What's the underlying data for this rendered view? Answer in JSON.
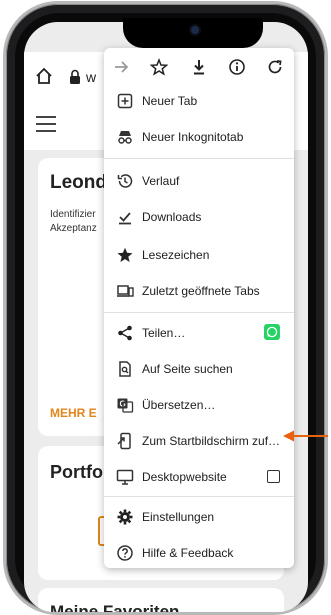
{
  "browser": {
    "url_text": "w"
  },
  "page": {
    "card1_title": "Leond",
    "card1_desc_line1": "Identifizier",
    "card1_desc_line2": "Akzeptanz",
    "card1_more": "MEHR E",
    "card2_title": "Portfo",
    "card3_title": "Meine Favoriten"
  },
  "menu": {
    "toolbar_icons": [
      "forward-icon",
      "star-icon",
      "download-icon",
      "info-icon",
      "reload-icon"
    ],
    "items": [
      {
        "label": "Neuer Tab",
        "icon": "new-tab-icon"
      },
      {
        "label": "Neuer Inkognitotab",
        "icon": "incognito-icon"
      },
      {
        "label": "Verlauf",
        "icon": "history-icon"
      },
      {
        "label": "Downloads",
        "icon": "downloads-icon"
      },
      {
        "label": "Lesezeichen",
        "icon": "bookmarks-icon"
      },
      {
        "label": "Zuletzt geöffnete Tabs",
        "icon": "recent-tabs-icon"
      },
      {
        "label": "Teilen…",
        "icon": "share-icon"
      },
      {
        "label": "Auf Seite suchen",
        "icon": "find-in-page-icon"
      },
      {
        "label": "Übersetzen…",
        "icon": "translate-icon"
      },
      {
        "label": "Zum Startbildschirm zuf…",
        "icon": "add-to-home-icon"
      },
      {
        "label": "Desktopwebsite",
        "icon": "desktop-icon"
      },
      {
        "label": "Einstellungen",
        "icon": "settings-icon"
      },
      {
        "label": "Hilfe & Feedback",
        "icon": "help-icon"
      }
    ]
  },
  "colors": {
    "accent_orange": "#e8620f",
    "whatsapp_green": "#25d366",
    "more_link_orange": "#e0861a"
  }
}
